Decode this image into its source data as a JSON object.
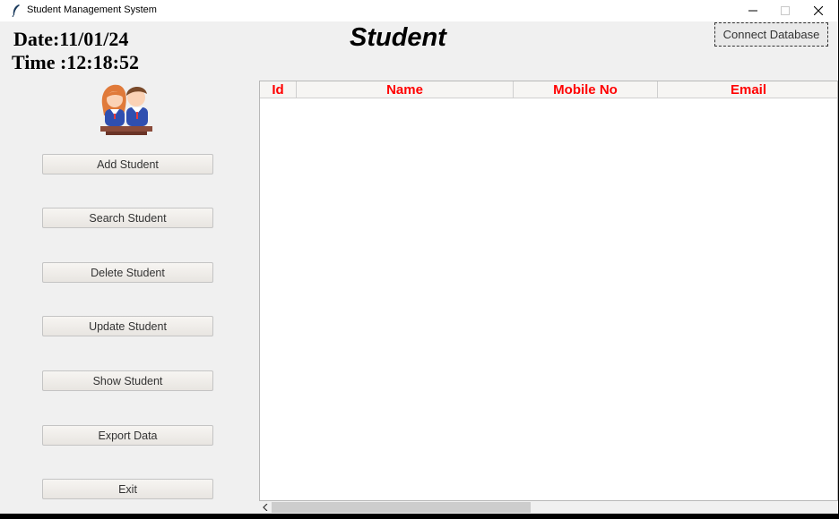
{
  "window": {
    "title": "Student Management System",
    "icon": "feather-icon",
    "controls": [
      "minimize-icon",
      "maximize-icon",
      "close-icon"
    ]
  },
  "header": {
    "date": "Date:11/01/24",
    "time": "Time :12:18:52",
    "heading": "Student",
    "connect_label": "Connect Database"
  },
  "sidebar": {
    "logo": "students-icon",
    "buttons": [
      {
        "label": "Add Student"
      },
      {
        "label": "Search Student"
      },
      {
        "label": "Delete Student"
      },
      {
        "label": "Update Student"
      },
      {
        "label": "Show Student"
      },
      {
        "label": "Export Data"
      },
      {
        "label": "Exit"
      }
    ]
  },
  "table": {
    "columns": [
      "Id",
      "Name",
      "Mobile No",
      "Email"
    ],
    "rows": []
  },
  "colors": {
    "header_text": "#ff0000",
    "window_bg": "#f0f0f0"
  }
}
